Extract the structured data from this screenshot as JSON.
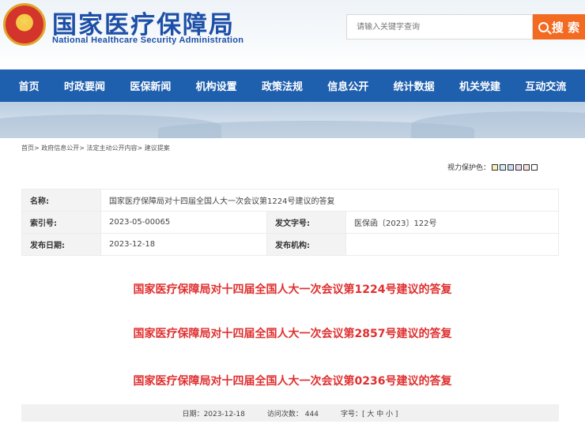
{
  "header": {
    "title_cn": "国家医疗保障局",
    "title_en": "National Healthcare Security Administration",
    "search_placeholder": "请输入关键字查询",
    "search_button": "搜 索"
  },
  "nav": [
    "首页",
    "时政要闻",
    "医保新闻",
    "机构设置",
    "政策法规",
    "信息公开",
    "统计数据",
    "机关党建",
    "互动交流"
  ],
  "breadcrumb": [
    "首页>",
    "政府信息公开>",
    "法定主动公开内容>",
    "建议提案"
  ],
  "color_protect": {
    "label": "视力保护色：",
    "swatches": [
      "#f7f2b5",
      "#cfeef5",
      "#c8dcf2",
      "#e9d6ef",
      "#f6dcdc",
      "#ffffff"
    ]
  },
  "meta": {
    "name_label": "名称:",
    "name_value": "国家医疗保障局对十四届全国人大一次会议第1224号建议的答复",
    "index_label": "索引号:",
    "index_value": "2023-05-00065",
    "docno_label": "发文字号:",
    "docno_value": "医保函〔2023〕122号",
    "date_label": "发布日期:",
    "date_value": "2023-12-18",
    "org_label": "发布机构:",
    "org_value": ""
  },
  "related": [
    "国家医疗保障局对十四届全国人大一次会议第1224号建议的答复",
    "国家医疗保障局对十四届全国人大一次会议第2857号建议的答复",
    "国家医疗保障局对十四届全国人大一次会议第0236号建议的答复"
  ],
  "footer": {
    "date": "日期：2023-12-18",
    "visits": "访问次数：  444",
    "fontsize": "字号：[ 大 中 小 ]"
  }
}
